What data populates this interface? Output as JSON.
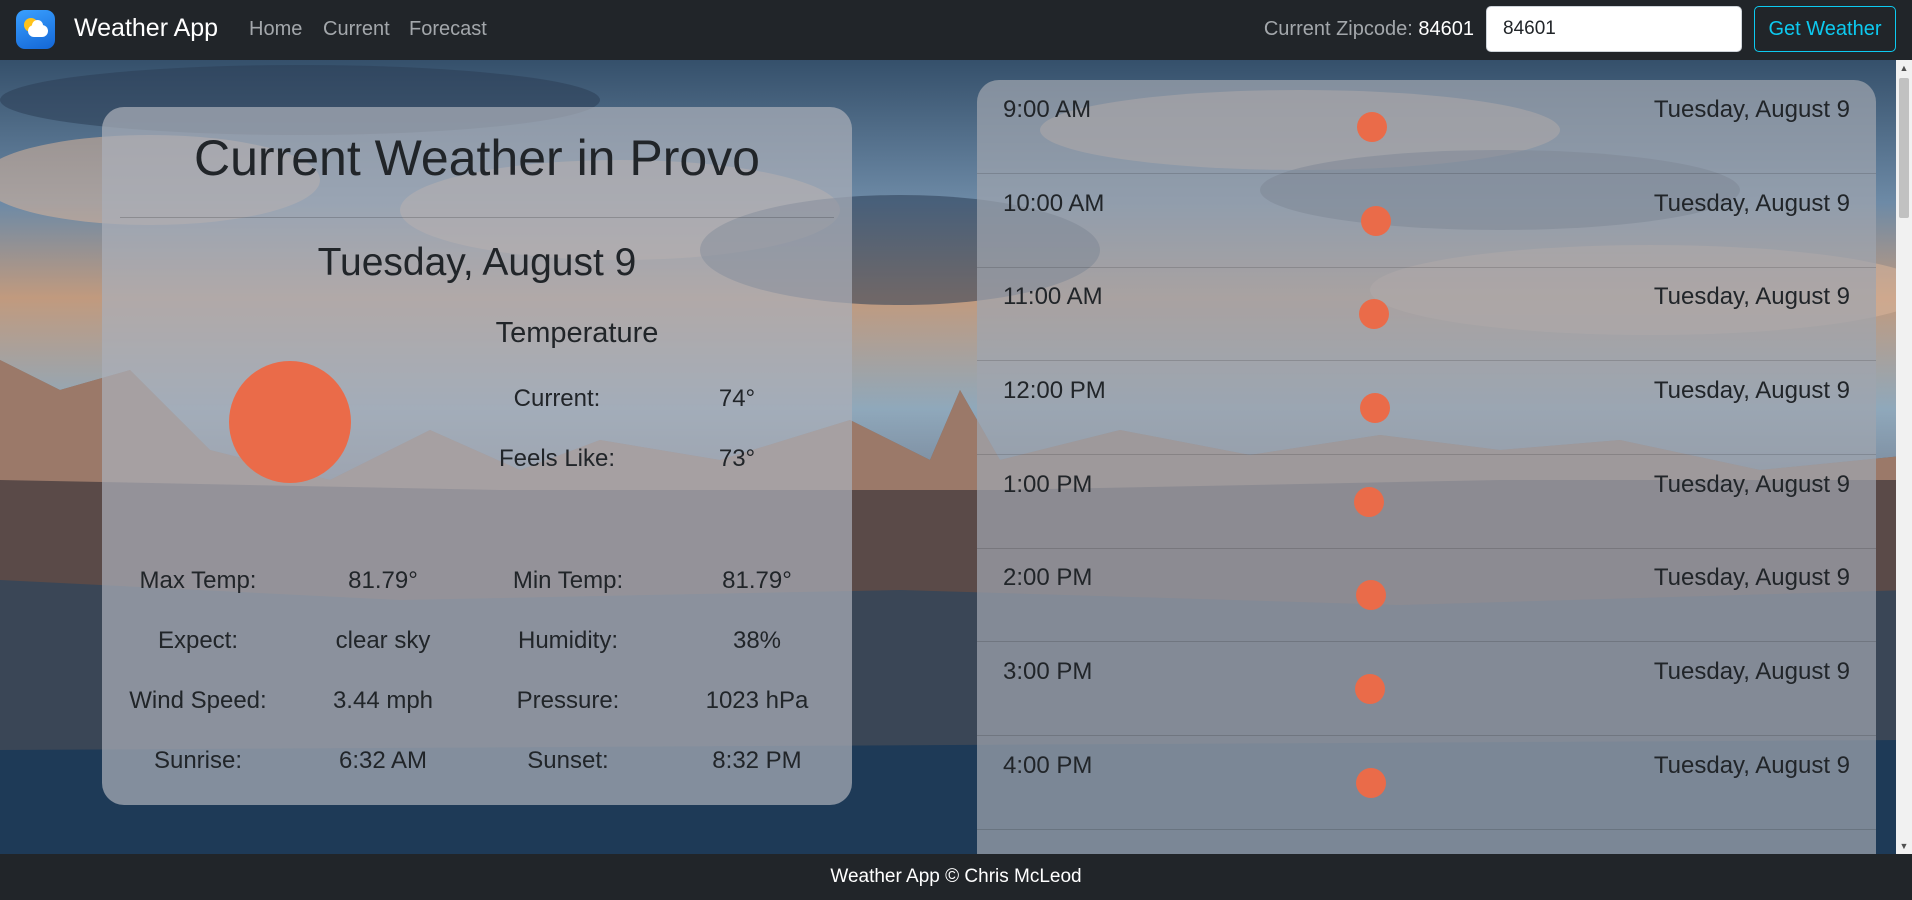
{
  "navbar": {
    "brand": "Weather App",
    "links": [
      "Home",
      "Current",
      "Forecast"
    ],
    "zip_label": "Current Zipcode:",
    "zip_value": "84601",
    "zip_input_value": "84601",
    "button_label": "Get Weather"
  },
  "current": {
    "title": "Current Weather in Provo",
    "date": "Tuesday, August 9",
    "icon": "sun-icon",
    "temperature_heading": "Temperature",
    "current_label": "Current:",
    "current_value": "74°",
    "feels_label": "Feels Like:",
    "feels_value": "73°",
    "details": [
      {
        "label": "Max Temp:",
        "value": "81.79°"
      },
      {
        "label": "Min Temp:",
        "value": "81.79°"
      },
      {
        "label": "Expect:",
        "value": "clear sky"
      },
      {
        "label": "Humidity:",
        "value": "38%"
      },
      {
        "label": "Wind Speed:",
        "value": "3.44 mph"
      },
      {
        "label": "Pressure:",
        "value": "1023 hPa"
      },
      {
        "label": "Sunrise:",
        "value": "6:32 AM"
      },
      {
        "label": "Sunset:",
        "value": "8:32 PM"
      }
    ]
  },
  "forecast": {
    "hours": [
      {
        "time": "9:00 AM",
        "date": "Tuesday, August 9",
        "icon": "sun-icon"
      },
      {
        "time": "10:00 AM",
        "date": "Tuesday, August 9",
        "icon": "sun-icon"
      },
      {
        "time": "11:00 AM",
        "date": "Tuesday, August 9",
        "icon": "sun-icon"
      },
      {
        "time": "12:00 PM",
        "date": "Tuesday, August 9",
        "icon": "sun-icon"
      },
      {
        "time": "1:00 PM",
        "date": "Tuesday, August 9",
        "icon": "sun-icon"
      },
      {
        "time": "2:00 PM",
        "date": "Tuesday, August 9",
        "icon": "sun-icon"
      },
      {
        "time": "3:00 PM",
        "date": "Tuesday, August 9",
        "icon": "sun-icon"
      },
      {
        "time": "4:00 PM",
        "date": "Tuesday, August 9",
        "icon": "sun-icon"
      }
    ]
  },
  "footer": {
    "text": "Weather App © Chris McLeod"
  },
  "colors": {
    "navbar_bg": "#212529",
    "accent_button": "#0dcaf0",
    "sun": "#ea6b49"
  }
}
